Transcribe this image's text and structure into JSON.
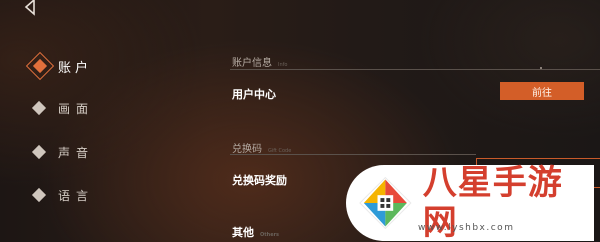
{
  "sidebar": {
    "items": [
      {
        "label": "账户",
        "active": true
      },
      {
        "label": "画面",
        "active": false
      },
      {
        "label": "声音",
        "active": false
      },
      {
        "label": "语言",
        "active": false
      }
    ]
  },
  "sections": {
    "account_info": {
      "title": "账户信息",
      "eng": "Info"
    },
    "user_center": {
      "label": "用户中心",
      "button": "前往"
    },
    "redeem": {
      "title": "兑换码",
      "eng": "Gift Code"
    },
    "redeem_reward": {
      "label": "兑换码奖励"
    },
    "other": {
      "title": "其他",
      "eng": "Others"
    }
  },
  "watermark": {
    "text": "八星手游网",
    "url": "www.lyshbx.com"
  },
  "colors": {
    "accent": "#d35e28",
    "watermark_red": "#d43f2e"
  }
}
